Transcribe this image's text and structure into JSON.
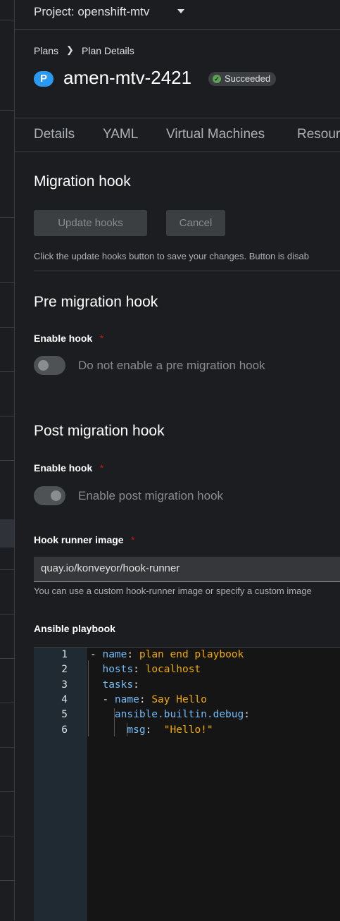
{
  "project": {
    "label": "Project: openshift-mtv"
  },
  "breadcrumb": {
    "parent": "Plans",
    "current": "Plan Details"
  },
  "plan": {
    "badge": "P",
    "name": "amen-mtv-2421",
    "status": "Succeeded"
  },
  "tabs": [
    "Details",
    "YAML",
    "Virtual Machines",
    "Resour"
  ],
  "migration_hook": {
    "title": "Migration hook",
    "update_label": "Update hooks",
    "cancel_label": "Cancel",
    "help": "Click the update hooks button to save your changes. Button is disab"
  },
  "pre_hook": {
    "title": "Pre migration hook",
    "enable_label": "Enable hook",
    "required_mark": "*",
    "switch_label": "Do not enable a pre migration hook"
  },
  "post_hook": {
    "title": "Post migration hook",
    "enable_label": "Enable hook",
    "required_mark": "*",
    "switch_label": "Enable post migration hook",
    "image_label": "Hook runner image",
    "image_value": "quay.io/konveyor/hook-runner",
    "image_help": "You can use a custom hook-runner image or specify a custom image",
    "playbook_label": "Ansible playbook"
  },
  "playbook": {
    "line_numbers": [
      "1",
      "2",
      "3",
      "4",
      "5",
      "6"
    ],
    "lines": [
      [
        {
          "t": "- ",
          "c": "p"
        },
        {
          "t": "name",
          "c": "k"
        },
        {
          "t": ": ",
          "c": "p"
        },
        {
          "t": "plan end playbook",
          "c": "s"
        }
      ],
      [
        {
          "t": "  ",
          "c": "p"
        },
        {
          "t": "hosts",
          "c": "k"
        },
        {
          "t": ": ",
          "c": "p"
        },
        {
          "t": "localhost",
          "c": "s"
        }
      ],
      [
        {
          "t": "  ",
          "c": "p"
        },
        {
          "t": "tasks",
          "c": "k"
        },
        {
          "t": ":",
          "c": "p"
        }
      ],
      [
        {
          "t": "  - ",
          "c": "p"
        },
        {
          "t": "name",
          "c": "k"
        },
        {
          "t": ": ",
          "c": "p"
        },
        {
          "t": "Say Hello",
          "c": "s"
        }
      ],
      [
        {
          "t": "    ",
          "c": "p"
        },
        {
          "t": "ansible.builtin.debug",
          "c": "k"
        },
        {
          "t": ":",
          "c": "p"
        }
      ],
      [
        {
          "t": "      ",
          "c": "p"
        },
        {
          "t": "msg",
          "c": "k"
        },
        {
          "t": ":  ",
          "c": "p"
        },
        {
          "t": "\"Hello!\"",
          "c": "s"
        }
      ]
    ]
  },
  "colors": {
    "accent": "#2b9af3",
    "success": "#5ba352",
    "required": "#c9190b",
    "key": "#73bcf7",
    "string": "#f0ab00"
  }
}
